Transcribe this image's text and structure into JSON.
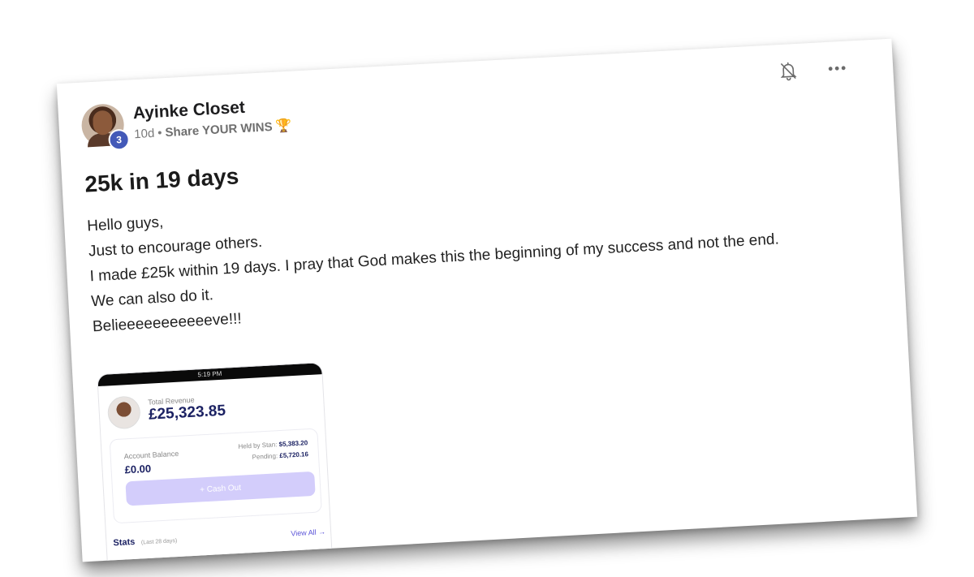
{
  "post": {
    "author_name": "Ayinke Closet",
    "level": "3",
    "age": "10d",
    "separator": "•",
    "category": "Share YOUR WINS",
    "category_emoji": "🏆",
    "title": "25k in 19 days",
    "body_lines": [
      "Hello guys,",
      "Just to encourage others.",
      "I made £25k within 19 days. I pray that God makes this the beginning of my success and not the end.",
      "We can also do it.",
      "Belieeeeeeeeeeeve!!!"
    ]
  },
  "icons": {
    "notification": "bell-off-icon",
    "more": "more-horizontal-icon"
  },
  "screenshot": {
    "status_time": "5:19 PM",
    "total_revenue_label": "Total Revenue",
    "total_revenue": "£25,323.85",
    "account_balance_label": "Account Balance",
    "account_balance": "£0.00",
    "held_label": "Held by Stan:",
    "held_value": "$5,383.20",
    "pending_label": "Pending:",
    "pending_value": "£5,720.16",
    "cash_out_label": "+ Cash Out",
    "stats_label": "Stats",
    "stats_sub": "(Last 28 days)",
    "view_all": "View All →"
  },
  "colors": {
    "badge": "#4359b8",
    "revenue_text": "#1c2263",
    "cash_out_button": "#d3cdfb",
    "link": "#5b54d8"
  }
}
